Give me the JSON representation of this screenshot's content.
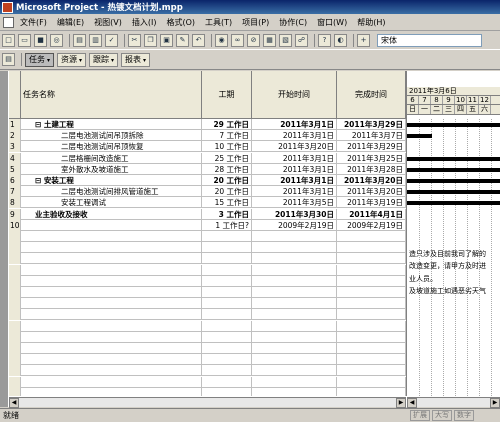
{
  "window": {
    "title": "Microsoft Project - 热镀文档计划.mpp"
  },
  "menu": [
    "文件(F)",
    "编辑(E)",
    "视图(V)",
    "插入(I)",
    "格式(O)",
    "工具(T)",
    "项目(P)",
    "协作(C)",
    "窗口(W)",
    "帮助(H)"
  ],
  "toolbar": {
    "font": "宋体"
  },
  "toolbar2": {
    "tasks": "任务",
    "resources": "资源",
    "track": "跟踪",
    "report": "报表"
  },
  "table": {
    "headers": {
      "name": "任务名称",
      "duration": "工期",
      "start": "开始时间",
      "finish": "完成时间"
    },
    "rows": [
      {
        "id": "1",
        "name": "⊟ 土建工程",
        "duration": "29 工作日",
        "start": "2011年3月1日",
        "finish": "2011年3月29日",
        "bold": true,
        "level": 0
      },
      {
        "id": "2",
        "name": "二层电池测试间吊顶拆除",
        "duration": "7 工作日",
        "start": "2011年3月1日",
        "finish": "2011年3月7日",
        "bold": false,
        "level": 1
      },
      {
        "id": "3",
        "name": "二层电池测试间吊顶恢复",
        "duration": "10 工作日",
        "start": "2011年3月20日",
        "finish": "2011年3月29日",
        "bold": false,
        "level": 1
      },
      {
        "id": "4",
        "name": "二层格栅间改造施工",
        "duration": "25 工作日",
        "start": "2011年3月1日",
        "finish": "2011年3月25日",
        "bold": false,
        "level": 1
      },
      {
        "id": "5",
        "name": "室外散水及坡道施工",
        "duration": "28 工作日",
        "start": "2011年3月1日",
        "finish": "2011年3月28日",
        "bold": false,
        "level": 1
      },
      {
        "id": "6",
        "name": "⊟ 安装工程",
        "duration": "20 工作日",
        "start": "2011年3月1日",
        "finish": "2011年3月20日",
        "bold": true,
        "level": 0
      },
      {
        "id": "7",
        "name": "二层电池测试间排风管道施工",
        "duration": "20 工作日",
        "start": "2011年3月1日",
        "finish": "2011年3月20日",
        "bold": false,
        "level": 1
      },
      {
        "id": "8",
        "name": "安装工程调试",
        "duration": "15 工作日",
        "start": "2011年3月5日",
        "finish": "2011年3月19日",
        "bold": false,
        "level": 1
      },
      {
        "id": "9",
        "name": "业主验收及接收",
        "duration": "3 工作日",
        "start": "2011年3月30日",
        "finish": "2011年4月1日",
        "bold": true,
        "level": 0
      },
      {
        "id": "10",
        "name": "",
        "duration": "1 工作日?",
        "start": "2009年2月19日",
        "finish": "2009年2月19日",
        "bold": false,
        "level": 1
      }
    ]
  },
  "gantt": {
    "week": "2011年3月6日",
    "days": [
      "6",
      "7",
      "8",
      "9",
      "10",
      "11",
      "12"
    ],
    "weekdays": [
      "日",
      "一",
      "二",
      "三",
      "四",
      "五",
      "六"
    ],
    "notes": [
      "造只涉及目前我司了解的",
      "改造变更，请甲方及时进",
      "业人员。",
      "及坡道施工如遇恶劣天气"
    ]
  },
  "status": {
    "text": "就绪",
    "ext": "扩展",
    "caps": "大写",
    "num": "数字"
  }
}
